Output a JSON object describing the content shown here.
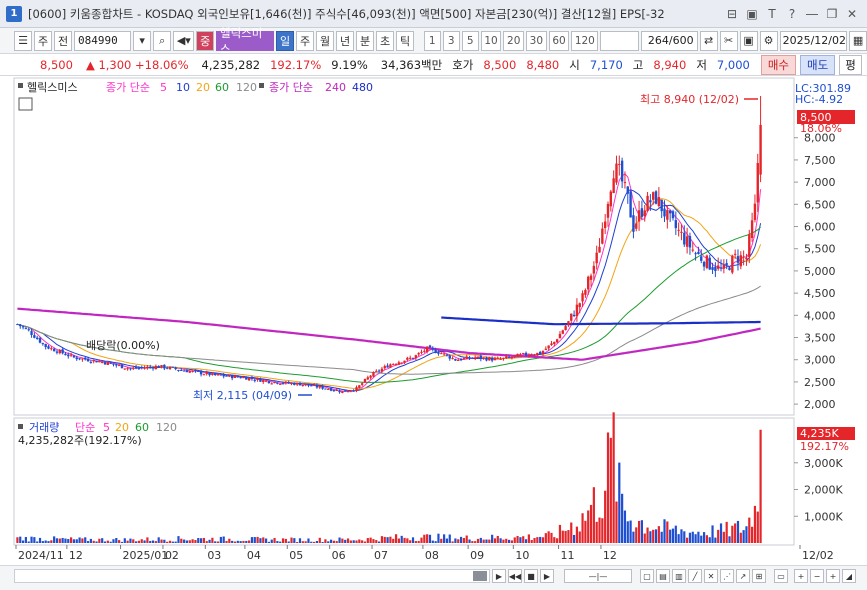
{
  "window": {
    "title": "[0600] 키움종합차트 - KOSDAQ 외국인보유[1,646(천)] 주식수[46,093(천)] 액면[500] 자본금[230(억)] 결산[12월] EPS[-32",
    "buttons": [
      "⊟",
      "▣",
      "T",
      "?",
      "―",
      "❐",
      "✕"
    ]
  },
  "toolbar": {
    "mode": "주",
    "prev": "전",
    "code": "084990",
    "stock_name": "헬릭스미스",
    "periods": [
      "일",
      "주",
      "월",
      "년",
      "분",
      "초",
      "틱"
    ],
    "active_period": "일",
    "intervals": [
      "1",
      "3",
      "5",
      "10",
      "20",
      "30",
      "60",
      "120"
    ],
    "count": "264",
    "count_total": "/600",
    "date": "2025/12/02"
  },
  "quote": {
    "price": "8,500",
    "change_arrow": "▲",
    "change": "1,300",
    "change_pct": "+18.06%",
    "volume": "4,235,282",
    "volume_ratio": "192.17%",
    "turnover": "9.19%",
    "amount": "34,363백만",
    "ask_label": "호가",
    "ask": "8,500",
    "bid": "8,480",
    "open_label": "시",
    "open": "7,170",
    "high_label": "고",
    "high": "8,940",
    "low_label": "저",
    "low": "7,000",
    "buy_label": "매수",
    "sell_label": "매도",
    "flat_label": "평"
  },
  "legend": {
    "stock": "헬릭스미스",
    "ma_label1": "종가 단순",
    "ma_values1": [
      "5",
      "10",
      "20",
      "60",
      "120"
    ],
    "ma_label2": "종가 단순",
    "ma_values2": [
      "240",
      "480"
    ],
    "volume_label": "거래량",
    "vol_ma_label": "단순",
    "vol_ma_values": [
      "5",
      "20",
      "60",
      "120"
    ],
    "volume_value": "4,235,282주(192.17%)"
  },
  "annotations": {
    "high": "최고 8,940 (12/02)",
    "low": "최저 2,115 (04/09)",
    "dividend": "배당락(0.00%)",
    "lc": "LC:301.89",
    "hc": "HC:-4.92",
    "price_tag": "8,500",
    "pct_tag": "18.06%",
    "vol_tag": "4,235K",
    "vol_pct_tag": "192.17%"
  },
  "colors": {
    "up": "#e4262b",
    "down": "#1f4fd1",
    "ma5": "#ff33cc",
    "ma10": "#1f3fd1",
    "ma20": "#f2a516",
    "ma60": "#1b9c2e",
    "ma120": "#8a8a8a",
    "ma240": "#c026c0",
    "ma480": "#1a2fc8"
  },
  "chart_data": {
    "type": "candlestick",
    "x_ticks": [
      "2024/11",
      "12",
      "2025/01",
      "02",
      "03",
      "04",
      "05",
      "06",
      "07",
      "08",
      "09",
      "10",
      "11",
      "12",
      "12/02"
    ],
    "y_ticks": [
      "8,000",
      "7,500",
      "7,000",
      "6,500",
      "6,000",
      "5,500",
      "5,000",
      "4,500",
      "4,000",
      "3,500",
      "3,000",
      "2,500",
      "2,000"
    ],
    "y_range": [
      1800,
      9300
    ],
    "volume_ticks": [
      "3,000K",
      "2,000K",
      "1,000K"
    ],
    "volume_range": [
      0,
      4600
    ],
    "price_profile": [
      [
        0,
        3800
      ],
      [
        4,
        3650
      ],
      [
        10,
        3300
      ],
      [
        20,
        3050
      ],
      [
        30,
        2950
      ],
      [
        40,
        2800
      ],
      [
        50,
        2850
      ],
      [
        60,
        2750
      ],
      [
        70,
        2650
      ],
      [
        80,
        2600
      ],
      [
        90,
        2500
      ],
      [
        100,
        2450
      ],
      [
        110,
        2350
      ],
      [
        115,
        2280
      ],
      [
        120,
        2350
      ],
      [
        125,
        2650
      ],
      [
        132,
        2900
      ],
      [
        140,
        3050
      ],
      [
        145,
        3250
      ],
      [
        150,
        3150
      ],
      [
        155,
        3000
      ],
      [
        162,
        3050
      ],
      [
        170,
        3000
      ],
      [
        178,
        3100
      ],
      [
        185,
        3150
      ],
      [
        190,
        3400
      ],
      [
        195,
        3850
      ],
      [
        200,
        4400
      ],
      [
        205,
        5300
      ],
      [
        208,
        6300
      ],
      [
        211,
        7300
      ],
      [
        213,
        7200
      ],
      [
        216,
        6600
      ],
      [
        218,
        6000
      ],
      [
        222,
        6500
      ],
      [
        226,
        6650
      ],
      [
        230,
        6200
      ],
      [
        235,
        5800
      ],
      [
        240,
        5400
      ],
      [
        245,
        5150
      ],
      [
        250,
        5000
      ],
      [
        254,
        5300
      ],
      [
        258,
        5300
      ],
      [
        261,
        6400
      ],
      [
        263,
        8500
      ]
    ],
    "volume_profile": [
      [
        0,
        180
      ],
      [
        20,
        130
      ],
      [
        40,
        120
      ],
      [
        60,
        160
      ],
      [
        80,
        140
      ],
      [
        100,
        120
      ],
      [
        120,
        130
      ],
      [
        140,
        230
      ],
      [
        160,
        180
      ],
      [
        180,
        220
      ],
      [
        190,
        270
      ],
      [
        195,
        600
      ],
      [
        200,
        900
      ],
      [
        205,
        1600
      ],
      [
        208,
        2200
      ],
      [
        211,
        3500
      ],
      [
        213,
        1800
      ],
      [
        216,
        1000
      ],
      [
        220,
        800
      ],
      [
        226,
        600
      ],
      [
        230,
        500
      ],
      [
        240,
        400
      ],
      [
        250,
        450
      ],
      [
        258,
        600
      ],
      [
        261,
        1300
      ],
      [
        263,
        4235
      ]
    ]
  }
}
